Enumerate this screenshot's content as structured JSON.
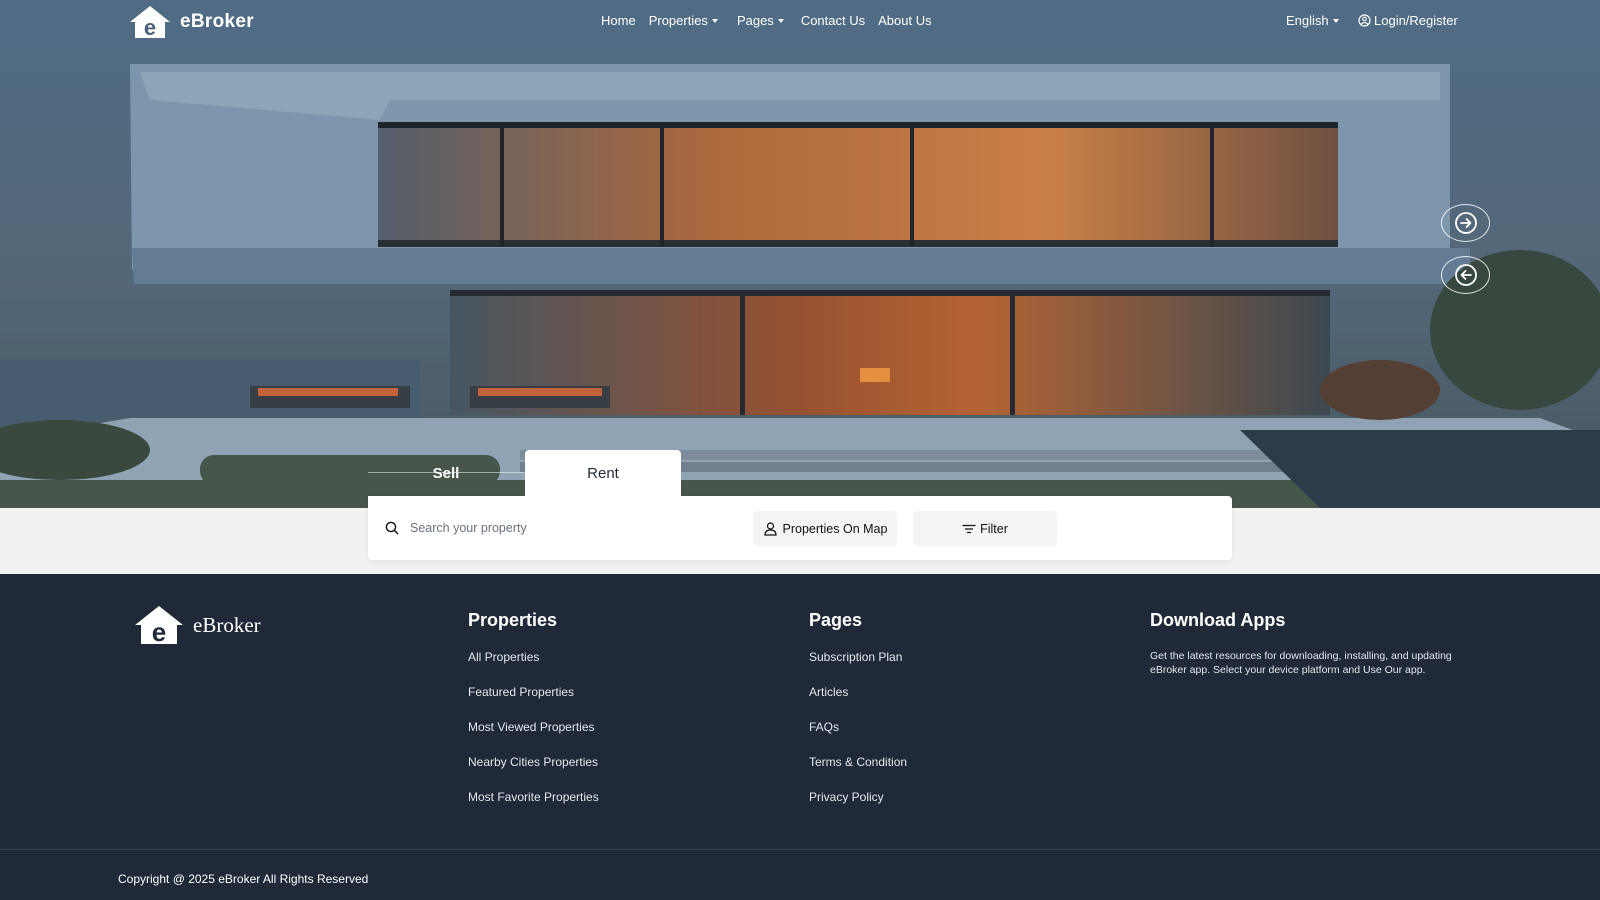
{
  "nav": {
    "brand": "eBroker",
    "menu": [
      {
        "label": "Home",
        "dropdown": false
      },
      {
        "label": "Properties",
        "dropdown": true
      },
      {
        "label": "Pages",
        "dropdown": true
      },
      {
        "label": "Contact Us",
        "dropdown": false
      },
      {
        "label": "About Us",
        "dropdown": false
      }
    ],
    "language": "English",
    "login": "Login/Register"
  },
  "hero": {
    "slider_controls": [
      "next-arrow-icon",
      "prev-arrow-icon"
    ]
  },
  "search": {
    "tabs": [
      {
        "label": "Sell",
        "active": false
      },
      {
        "label": "Rent",
        "active": true
      }
    ],
    "placeholder": "Search your property",
    "map_button": "Properties On Map",
    "filter_button": "Filter"
  },
  "footer": {
    "brand": "eBroker",
    "properties": {
      "title": "Properties",
      "links": [
        "All Properties",
        "Featured Properties",
        "Most Viewed Properties",
        "Nearby Cities Properties",
        "Most Favorite Properties"
      ]
    },
    "pages": {
      "title": "Pages",
      "links": [
        "Subscription Plan",
        "Articles",
        "FAQs",
        "Terms & Condition",
        "Privacy Policy"
      ]
    },
    "download": {
      "title": "Download Apps",
      "description": "Get the latest resources for downloading, installing, and updating eBroker app. Select your device platform and Use Our app."
    },
    "copyright": "Copyright @ 2025 eBroker All Rights Reserved"
  },
  "colors": {
    "footer_bg": "#1f2937",
    "band_bg": "#f1f1f1",
    "text_light": "#ffffff"
  }
}
